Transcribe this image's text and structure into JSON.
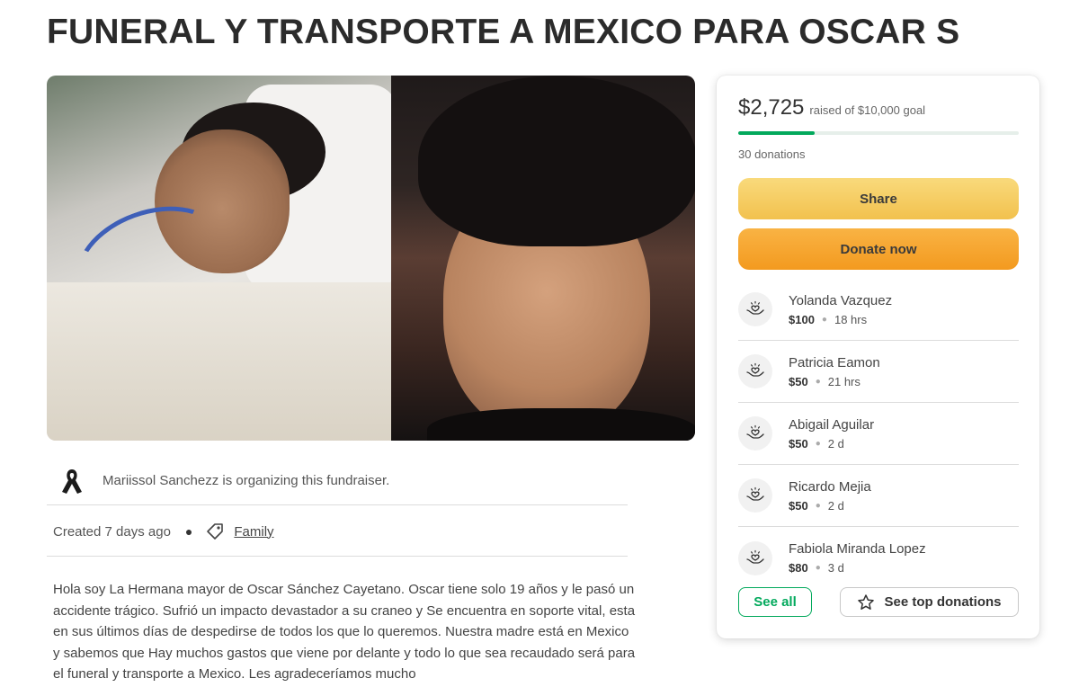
{
  "campaign": {
    "title": "FUNERAL Y TRANSPORTE A MEXICO PARA OSCAR S",
    "organizer_text": "Mariissol Sanchezz is organizing this fundraiser.",
    "created": "Created 7 days ago",
    "category": "Family",
    "story": "Hola soy La Hermana mayor de Oscar Sánchez Cayetano. Oscar tiene solo 19 años y le pasó un accidente trágico. Sufrió un impacto devastador a su craneo y Se encuentra en soporte vital, esta en sus últimos días de despedirse de todos los que lo queremos. Nuestra madre está en Mexico y sabemos que Hay muchos gastos que viene por delante y todo lo que sea recaudado será para el funeral y transporte a Mexico. Les agradeceríamos mucho"
  },
  "card": {
    "raised_amount": "$2,725",
    "raised_goal": "raised of $10,000 goal",
    "progress_fraction": 0.2725,
    "donation_count": "30 donations",
    "share_label": "Share",
    "donate_label": "Donate now",
    "donors": [
      {
        "name": "Yolanda Vazquez",
        "amount": "$100",
        "time": "18 hrs"
      },
      {
        "name": "Patricia Eamon",
        "amount": "$50",
        "time": "21 hrs"
      },
      {
        "name": "Abigail Aguilar",
        "amount": "$50",
        "time": "2 d"
      },
      {
        "name": "Ricardo Mejia",
        "amount": "$50",
        "time": "2 d"
      },
      {
        "name": "Fabiola Miranda Lopez",
        "amount": "$80",
        "time": "3 d"
      }
    ],
    "see_all_label": "See all",
    "see_top_label": "See top donations"
  },
  "icons": {
    "organizer": "mourning-ribbon-icon",
    "category": "tag-icon",
    "donor": "heart-hands-icon",
    "top_donations": "star-icon"
  },
  "colors": {
    "accent_green": "#02a95c",
    "share_yellow": "#f2c14e",
    "donate_orange": "#f39a1f"
  }
}
